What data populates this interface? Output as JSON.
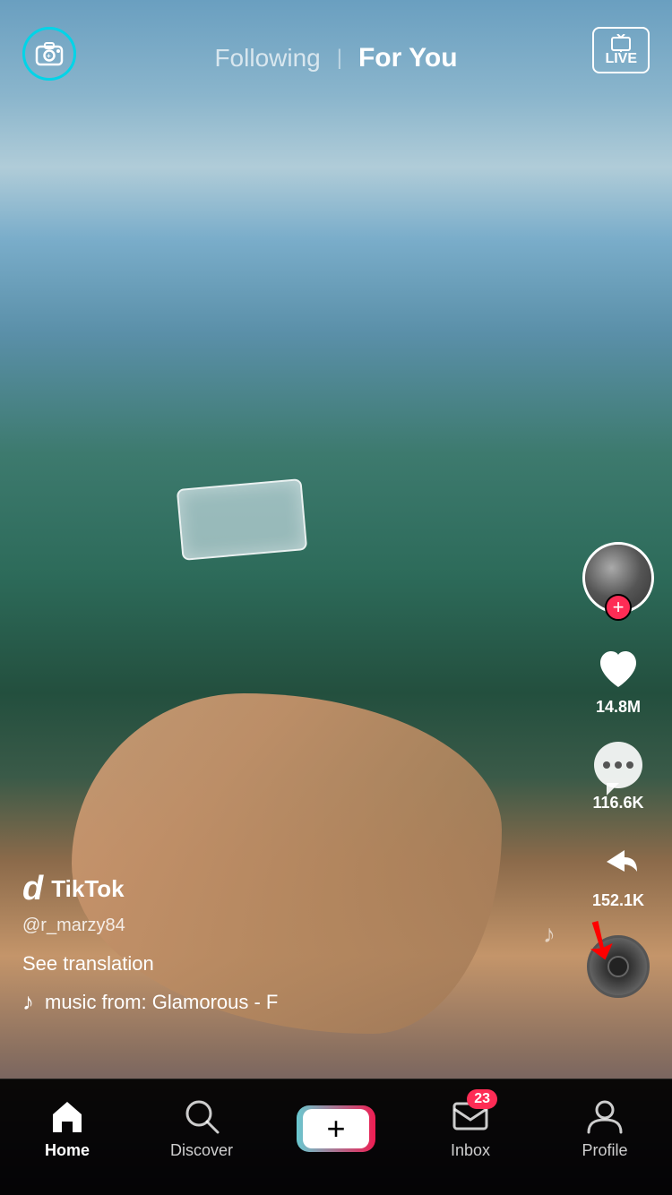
{
  "header": {
    "following_label": "Following",
    "foryou_label": "For You",
    "live_label": "LIVE",
    "divider": "|"
  },
  "video": {
    "creator": "@r_marzy84",
    "brand_name": "TikTok"
  },
  "actions": {
    "likes_count": "14.8M",
    "comments_count": "116.6K",
    "shares_count": "152.1K",
    "follow_plus": "+"
  },
  "bottom_info": {
    "see_translation": "See translation",
    "music_text": "music from: Glamorous - F"
  },
  "bottom_nav": {
    "home_label": "Home",
    "discover_label": "Discover",
    "inbox_label": "Inbox",
    "profile_label": "Profile",
    "inbox_badge": "23"
  }
}
